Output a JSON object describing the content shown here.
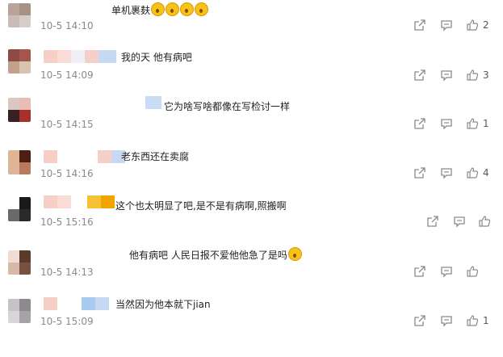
{
  "comments": [
    {
      "text": "单机裹麸",
      "emoji_count": 4,
      "time": "10-5 14:10",
      "likes": "2"
    },
    {
      "text": "我的天 他有病吧",
      "emoji_count": 0,
      "time": "10-5 14:09",
      "likes": "3"
    },
    {
      "text": "它为啥写啥都像在写检讨一样",
      "emoji_count": 0,
      "time": "10-5 14:15",
      "likes": "1"
    },
    {
      "text": "老东西还在卖腐",
      "emoji_count": 0,
      "time": "10-5 14:16",
      "likes": "4"
    },
    {
      "text": "这个也太明显了吧,是不是有病啊,照搬啊",
      "emoji_count": 0,
      "time": "10-5 15:16",
      "likes": ""
    },
    {
      "text": "他有病吧 人民日报不爱他他急了是吗",
      "emoji_count": 1,
      "time": "10-5 14:13",
      "likes": ""
    },
    {
      "text": "当然因为他本就下jian",
      "emoji_count": 0,
      "time": "10-5 15:09",
      "likes": "1"
    }
  ],
  "icons": {
    "share": "share-icon",
    "comment": "comment-icon",
    "like": "thumbs-up-icon"
  },
  "colors": {
    "time": "#8a8a8a",
    "icon": "#8a8a8a",
    "text": "#222222"
  }
}
